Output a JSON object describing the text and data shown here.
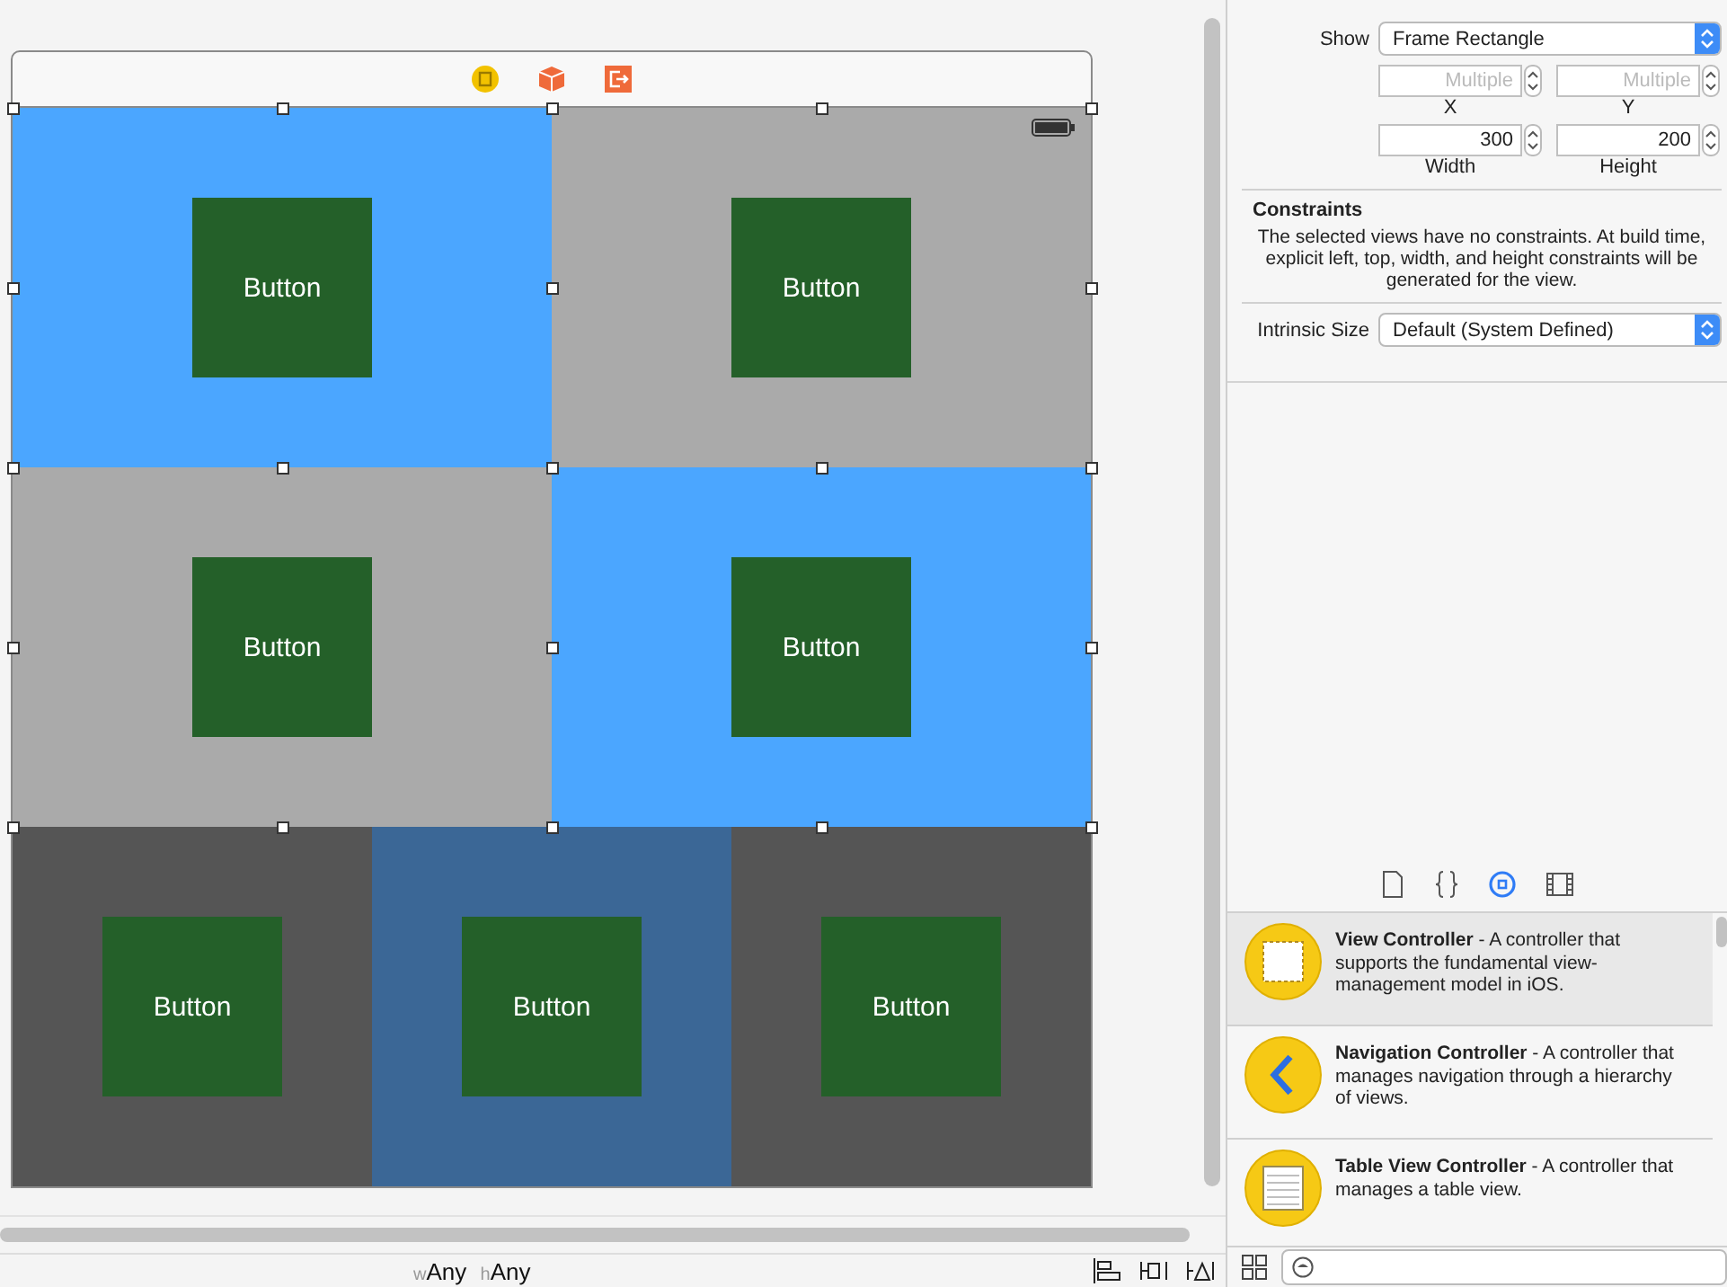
{
  "scene": {
    "rows": [
      {
        "cells": [
          {
            "color": "#4ba6ff",
            "selected": true,
            "button": "Button"
          },
          {
            "color": "#aaaaaa",
            "selected": true,
            "button": "Button"
          }
        ]
      },
      {
        "cells": [
          {
            "color": "#aaaaaa",
            "selected": true,
            "button": "Button"
          },
          {
            "color": "#4ba6ff",
            "selected": true,
            "button": "Button"
          }
        ]
      },
      {
        "cells": [
          {
            "color": "#555555",
            "selected": false,
            "button": "Button"
          },
          {
            "color": "#3b6796",
            "selected": false,
            "button": "Button"
          },
          {
            "color": "#555555",
            "selected": false,
            "button": "Button"
          }
        ]
      }
    ]
  },
  "size_class": {
    "width_prefix": "w",
    "width": "Any",
    "height_prefix": "h",
    "height": "Any"
  },
  "inspector": {
    "show": {
      "label": "Show",
      "value": "Frame Rectangle"
    },
    "fields": [
      {
        "label": "X",
        "placeholder": "Multiple"
      },
      {
        "label": "Y",
        "placeholder": "Multiple"
      },
      {
        "label": "Width",
        "value": "300"
      },
      {
        "label": "Height",
        "value": "200"
      }
    ],
    "constraints": {
      "title": "Constraints",
      "text": "The selected views have no constraints. At build time, explicit left, top, width, and height constraints will be generated for the view."
    },
    "intrinsic": {
      "label": "Intrinsic Size",
      "value": "Default (System Defined)"
    }
  },
  "library": {
    "tabs": [
      {
        "kind": "file",
        "selected": false
      },
      {
        "kind": "braces",
        "selected": false
      },
      {
        "kind": "object",
        "selected": true
      },
      {
        "kind": "media",
        "selected": false
      }
    ],
    "items": [
      {
        "kind": "view",
        "selected": true,
        "text": "**View Controller** - A controller that supports the fundamental view-management model in iOS."
      },
      {
        "kind": "navigation",
        "selected": false,
        "text": "**Navigation Controller** - A controller that manages navigation through a hierarchy of views."
      },
      {
        "kind": "table",
        "selected": false,
        "text": "**Table View Controller** - A controller that manages a table view."
      }
    ]
  }
}
